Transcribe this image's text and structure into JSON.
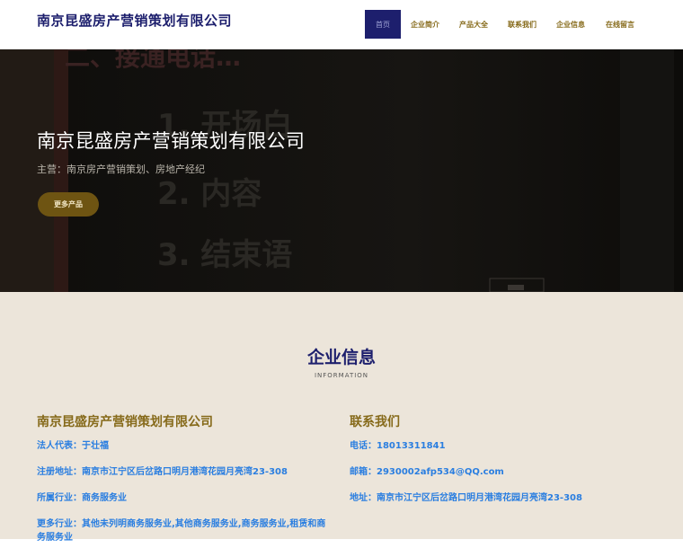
{
  "header": {
    "logo": "南京昆盛房产营销策划有限公司",
    "nav": [
      {
        "label": "首页",
        "active": true
      },
      {
        "label": "企业简介",
        "active": false
      },
      {
        "label": "产品大全",
        "active": false
      },
      {
        "label": "联系我们",
        "active": false
      },
      {
        "label": "企业信息",
        "active": false
      },
      {
        "label": "在线留言",
        "active": false
      }
    ]
  },
  "hero": {
    "title": "南京昆盛房产营销策划有限公司",
    "subtitle": "主营：南京房产营销策划、房地产经纪",
    "button": "更多产品",
    "bg_text": [
      "二、接通电话…",
      "1. 开场白",
      "2. 内容",
      "3. 结束语"
    ]
  },
  "info": {
    "title": "企业信息",
    "subtitle": "INFORMATION",
    "company": {
      "heading": "南京昆盛房产营销策划有限公司",
      "legal_label": "法人代表：",
      "legal": "于壮福",
      "address_label": "注册地址：",
      "address": "南京市江宁区后岔路口明月港湾花园月亮湾23-308",
      "industry_label": "所属行业：",
      "industry": "商务服务业",
      "more_label": "更多行业：",
      "more": "其他未列明商务服务业,其他商务服务业,商务服务业,租赁和商务服务业"
    },
    "contact": {
      "heading": "联系我们",
      "phone_label": "电话：",
      "phone": "18013311841",
      "email_label": "邮箱：",
      "email": "2930002afp534@QQ.com",
      "address_label": "地址：",
      "address": "南京市江宁区后岔路口明月港湾花园月亮湾23-308"
    }
  },
  "colors": {
    "navy": "#1d1f6d",
    "gold": "#866a1a",
    "link": "#2a7ee0",
    "info_bg": "#ece5da"
  }
}
